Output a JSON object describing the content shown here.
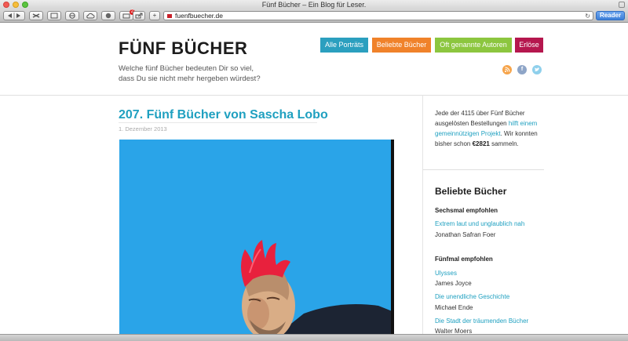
{
  "window": {
    "title": "Fünf Bücher – Ein Blog für Leser."
  },
  "toolbar": {
    "url": "fuenfbuecher.de",
    "reader_label": "Reader",
    "reading_list_badge": "2",
    "new_tab_label": "+"
  },
  "site": {
    "title": "FÜNF BÜCHER",
    "tagline_line1": "Welche fünf Bücher bedeuten Dir so viel,",
    "tagline_line2": "dass Du sie nicht mehr hergeben würdest?"
  },
  "nav": [
    {
      "label": "Alle Porträts",
      "color": "#2b9fbf"
    },
    {
      "label": "Beliebte Bücher",
      "color": "#f0822a"
    },
    {
      "label": "Oft genannte Autoren",
      "color": "#8cc63f"
    },
    {
      "label": "Erlöse",
      "color": "#b5174e"
    }
  ],
  "social": {
    "rss": "rss-icon",
    "facebook": "facebook-icon",
    "twitter": "twitter-icon"
  },
  "post": {
    "title": "207. Fünf Bücher von Sascha Lobo",
    "date": "1. Dezember 2013"
  },
  "sidebar": {
    "intro_1": "Jede der 4115 über Fünf Bücher ausgelösten Bestellungen ",
    "intro_link": "hilft einem gemeinnützigen Projekt",
    "intro_2": ". Wir konnten bisher schon ",
    "intro_amount": "€2821",
    "intro_3": " sammeln.",
    "heading": "Beliebte Bücher",
    "groups": [
      {
        "label": "Sechsmal empfohlen",
        "books": [
          {
            "title": "Extrem laut und unglaublich nah",
            "author": "Jonathan Safran Foer"
          }
        ]
      },
      {
        "label": "Fünfmal empfohlen",
        "books": [
          {
            "title": "Ulysses",
            "author": "James Joyce"
          },
          {
            "title": "Die unendliche Geschichte",
            "author": "Michael Ende"
          },
          {
            "title": "Die Stadt der träumenden Bücher",
            "author": "Walter Moers"
          }
        ]
      }
    ]
  },
  "colors": {
    "accent": "#1fa0c0",
    "sky": "#2aa4e8",
    "mohawk": "#e8213d"
  }
}
